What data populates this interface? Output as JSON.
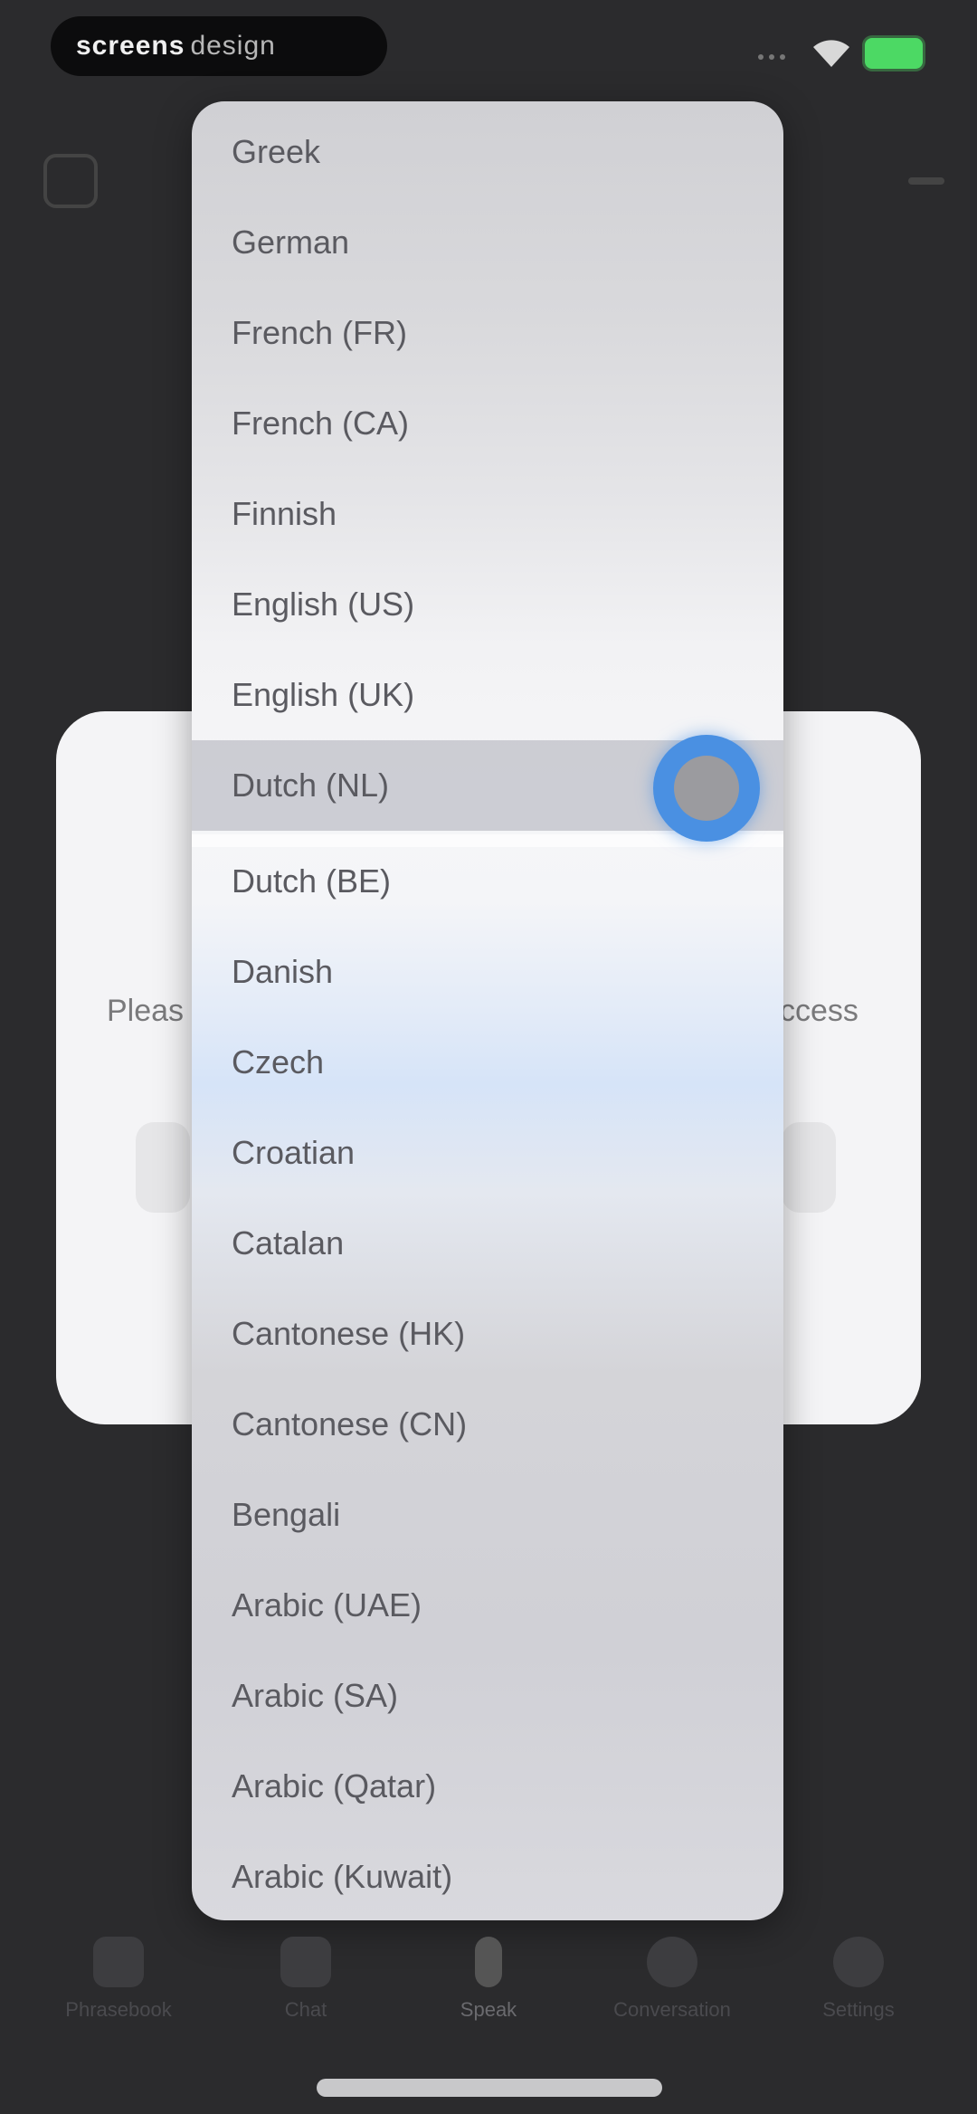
{
  "status_bar": {
    "app_title_bold": "screens",
    "app_title_light": "design",
    "battery_color": "#4cd964"
  },
  "dialog": {
    "text_left": "Pleas",
    "text_right": "ccess"
  },
  "language_menu": {
    "items": [
      "Greek",
      "German",
      "French (FR)",
      "French (CA)",
      "Finnish",
      "English (US)",
      "English (UK)",
      "Dutch (NL)",
      "Dutch (BE)",
      "Danish",
      "Czech",
      "Croatian",
      "Catalan",
      "Cantonese (HK)",
      "Cantonese (CN)",
      "Bengali",
      "Arabic (UAE)",
      "Arabic (SA)",
      "Arabic (Qatar)",
      "Arabic (Kuwait)"
    ],
    "highlighted_item": "Dutch (NL)"
  },
  "tab_bar": {
    "tabs": [
      {
        "label": "Phrasebook",
        "icon": "book-icon"
      },
      {
        "label": "Chat",
        "icon": "chat-icon"
      },
      {
        "label": "Speak",
        "icon": "microphone-icon"
      },
      {
        "label": "Conversation",
        "icon": "conversation-icon"
      },
      {
        "label": "Settings",
        "icon": "settings-icon"
      }
    ],
    "active_tab": "Speak"
  },
  "colors": {
    "touch_indicator": "#4a90e2",
    "background": "#2b2b2d"
  }
}
